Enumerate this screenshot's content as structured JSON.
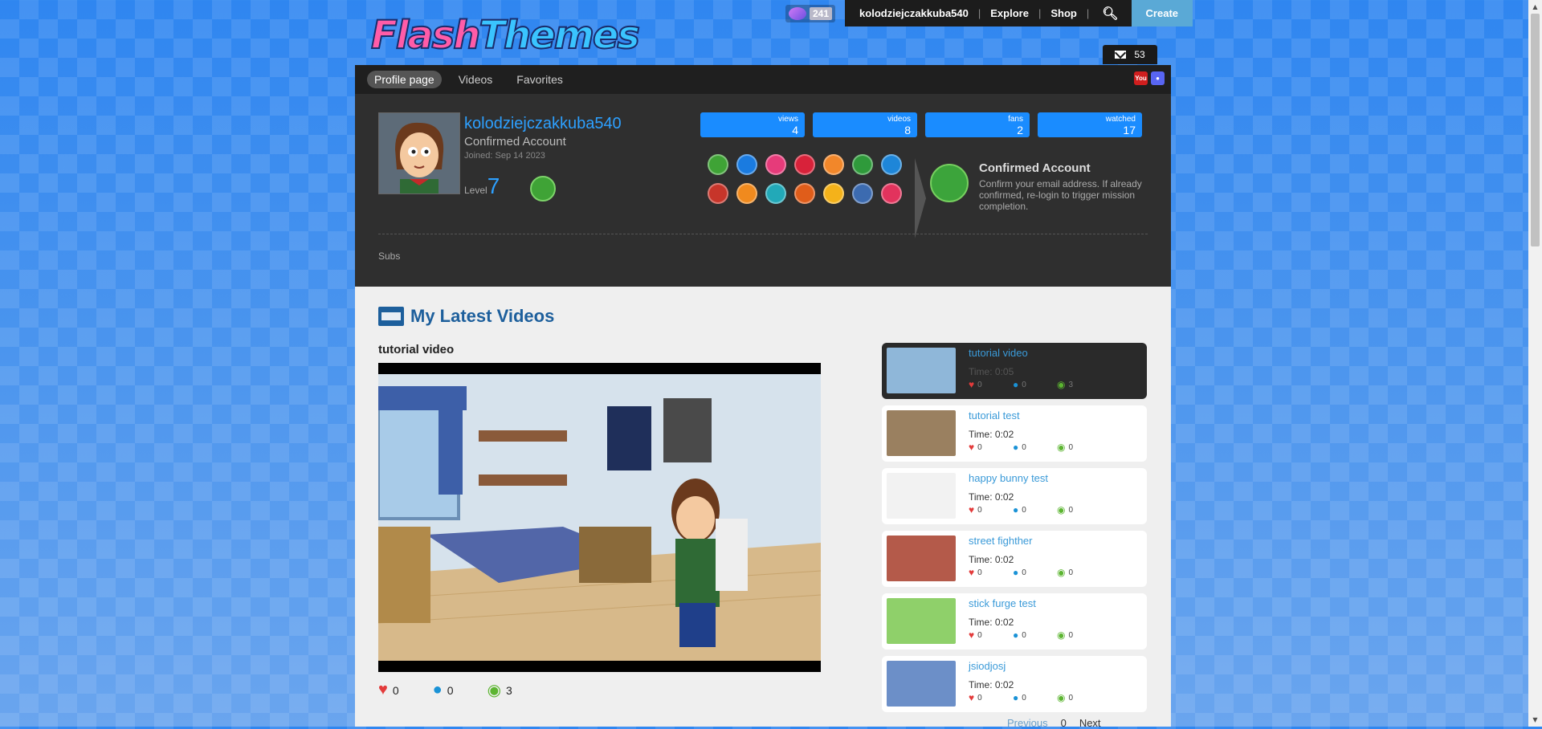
{
  "brand": {
    "logo_part1": "Flash",
    "logo_part2": "Themes"
  },
  "topbar": {
    "coins": "241",
    "username": "kolodziejczakkuba540",
    "explore": "Explore",
    "shop": "Shop",
    "create": "Create",
    "search_icon": "search-icon"
  },
  "mail": {
    "count": "53"
  },
  "subnav": {
    "tabs": [
      {
        "label": "Profile page"
      },
      {
        "label": "Videos"
      },
      {
        "label": "Favorites"
      }
    ],
    "social": [
      "youtube-icon",
      "discord-icon"
    ]
  },
  "profile": {
    "username": "kolodziejczakkuba540",
    "account_type": "Confirmed Account",
    "joined": "Joined: Sep 14 2023",
    "level_label": "Level",
    "level": "7",
    "subs_label": "Subs"
  },
  "stats": [
    {
      "label": "views",
      "value": "4"
    },
    {
      "label": "videos",
      "value": "8"
    },
    {
      "label": "fans",
      "value": "2"
    },
    {
      "label": "watched",
      "value": "17"
    }
  ],
  "mission": {
    "title": "Confirmed Account",
    "description": "Confirm your email address. If already confirmed, re-login to trigger mission completion."
  },
  "badge_colors": [
    "#3fa336",
    "#1a7be0",
    "#e63b7a",
    "#d8223a",
    "#f2872a",
    "#2f9a3b",
    "#1e86d8",
    "#c7352a",
    "#f08a1e",
    "#22a9b8",
    "#e05d1a",
    "#f4b21a",
    "#3c6bb0",
    "#e2335d"
  ],
  "latest": {
    "heading": "My Latest Videos",
    "current_title": "tutorial video",
    "likes": "0",
    "comments": "0",
    "views": "3"
  },
  "videos": [
    {
      "title": "tutorial video",
      "time": "Time: 0:05",
      "likes": "0",
      "comments": "0",
      "views": "3"
    },
    {
      "title": "tutorial test",
      "time": "Time: 0:02",
      "likes": "0",
      "comments": "0",
      "views": "0"
    },
    {
      "title": "happy bunny test",
      "time": "Time: 0:02",
      "likes": "0",
      "comments": "0",
      "views": "0"
    },
    {
      "title": "street fighther",
      "time": "Time: 0:02",
      "likes": "0",
      "comments": "0",
      "views": "0"
    },
    {
      "title": "stick furge test",
      "time": "Time: 0:02",
      "likes": "0",
      "comments": "0",
      "views": "0"
    },
    {
      "title": "jsiodjosj",
      "time": "Time: 0:02",
      "likes": "0",
      "comments": "0",
      "views": "0"
    }
  ],
  "pager": {
    "previous": "Previous",
    "page": "0",
    "next": "Next"
  }
}
